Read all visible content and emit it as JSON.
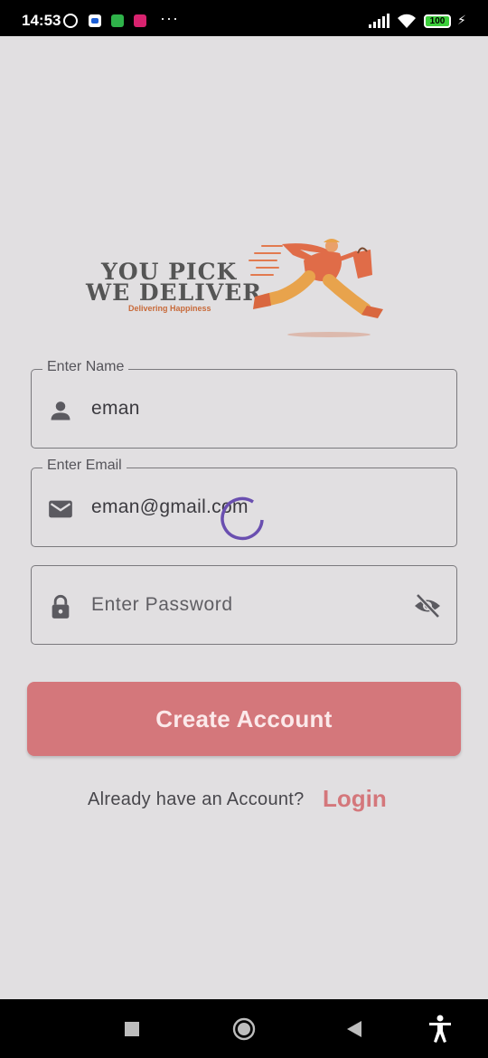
{
  "status_bar": {
    "time": "14:53",
    "more": "···",
    "battery": "100",
    "icons": [
      "alarm-icon",
      "app-notification-icon",
      "app-notification-icon",
      "app-notification-icon",
      "signal-icon",
      "wifi-icon",
      "battery-icon",
      "charging-icon"
    ]
  },
  "logo": {
    "line1": "YOU PICK",
    "line2": "WE DELIVER",
    "tagline": "Delivering Happiness"
  },
  "form": {
    "name": {
      "label": "Enter Name",
      "value": "eman",
      "icon": "person-icon"
    },
    "email": {
      "label": "Enter Email",
      "value": "eman@gmail.com",
      "icon": "mail-icon"
    },
    "password": {
      "placeholder": "Enter Password",
      "icon": "lock-icon",
      "toggle_icon": "visibility-off-icon"
    }
  },
  "create_button": "Create Account",
  "login_row": {
    "question": "Already have an Account?",
    "link": "Login"
  },
  "colors": {
    "accent": "#d4777b",
    "background": "#e1dfe1",
    "spinner": "#6a4fb0"
  },
  "nav_bar": {
    "icons": [
      "recents-icon",
      "home-icon",
      "back-icon",
      "accessibility-icon"
    ]
  }
}
